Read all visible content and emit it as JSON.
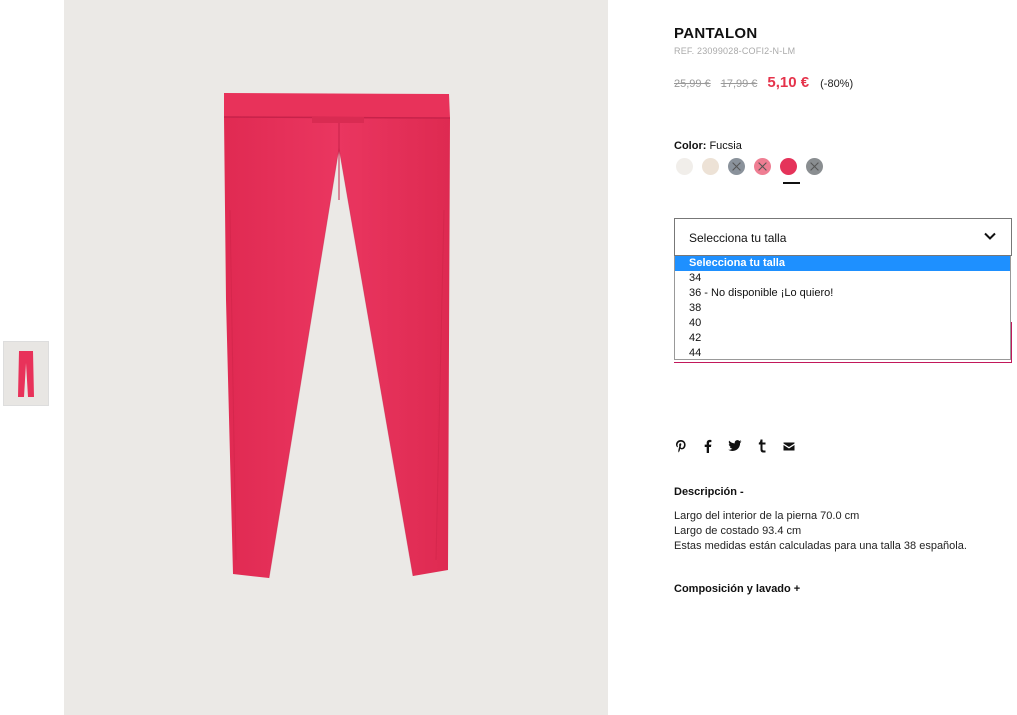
{
  "product": {
    "title": "PANTALON",
    "ref": "REF. 23099028-COFI2-N-LM",
    "old_price_1": "25,99 €",
    "old_price_2": "17,99 €",
    "sale_price": "5,10 €",
    "discount": "(-80%)"
  },
  "color": {
    "label": "Color:",
    "value": "Fucsia",
    "swatches": [
      {
        "color": "#f1eeea",
        "available": true
      },
      {
        "color": "#ede2d6",
        "available": true
      },
      {
        "color": "#8a929b",
        "available": false
      },
      {
        "color": "#ef7e93",
        "available": false
      },
      {
        "color": "#e5335a",
        "available": true,
        "selected": true
      },
      {
        "color": "#8a8e91",
        "available": false
      }
    ]
  },
  "size": {
    "placeholder": "Selecciona tu talla",
    "options": [
      "Selecciona tu talla",
      "34",
      "36 - No disponible ¡Lo quiero!",
      "38",
      "40",
      "42",
      "44"
    ]
  },
  "share": {
    "icons": [
      "pinterest-icon",
      "facebook-icon",
      "twitter-icon",
      "tumblr-icon",
      "email-icon"
    ]
  },
  "description": {
    "title": "Descripción -",
    "lines": [
      "Largo del interior de la pierna 70.0 cm",
      "Largo de costado 93.4 cm",
      "Estas medidas están calculadas para una talla 38 española."
    ]
  },
  "composition": {
    "title": "Composición y lavado +"
  },
  "colors": {
    "accent": "#e5334b",
    "product": "#e8325a",
    "selected_option": "#1e90ff"
  }
}
